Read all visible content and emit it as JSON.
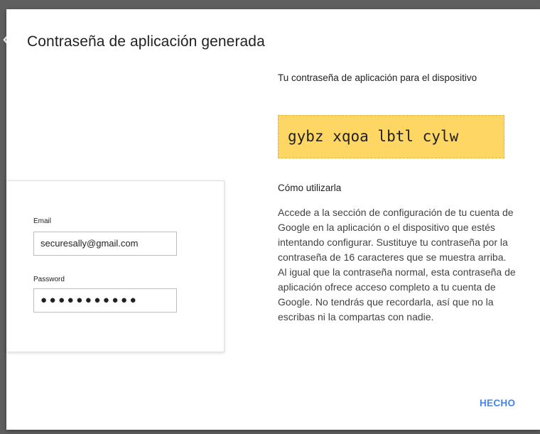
{
  "dialog": {
    "title": "Contraseña de aplicación generada",
    "done_label": "HECHO"
  },
  "login_card": {
    "email_label": "Email",
    "email_value": "securesally@gmail.com",
    "password_label": "Password",
    "password_value": "●●●●●●●●●●●"
  },
  "right": {
    "device_text": "Tu contraseña de aplicación para el dispositivo",
    "app_password": "gybz xqoa lbtl cylw",
    "howto_title": "Cómo utilizarla",
    "instructions_p1": "Accede a la sección de configuración de tu cuenta de Google en la aplicación o el dispositivo que estés intentando configurar. Sustituye tu contraseña por la contraseña de 16 caracteres que se muestra arriba.",
    "instructions_p2": "Al igual que la contraseña normal, esta contraseña de aplicación ofrece acceso completo a tu cuenta de Google. No tendrás que recordarla, así que no la escribas ni la compartas con nadie."
  },
  "colors": {
    "backdrop": "#5f5f5f",
    "password_bg": "#fdd663",
    "accent": "#4285f4"
  },
  "icons": {
    "back": "arrow-left-icon"
  }
}
